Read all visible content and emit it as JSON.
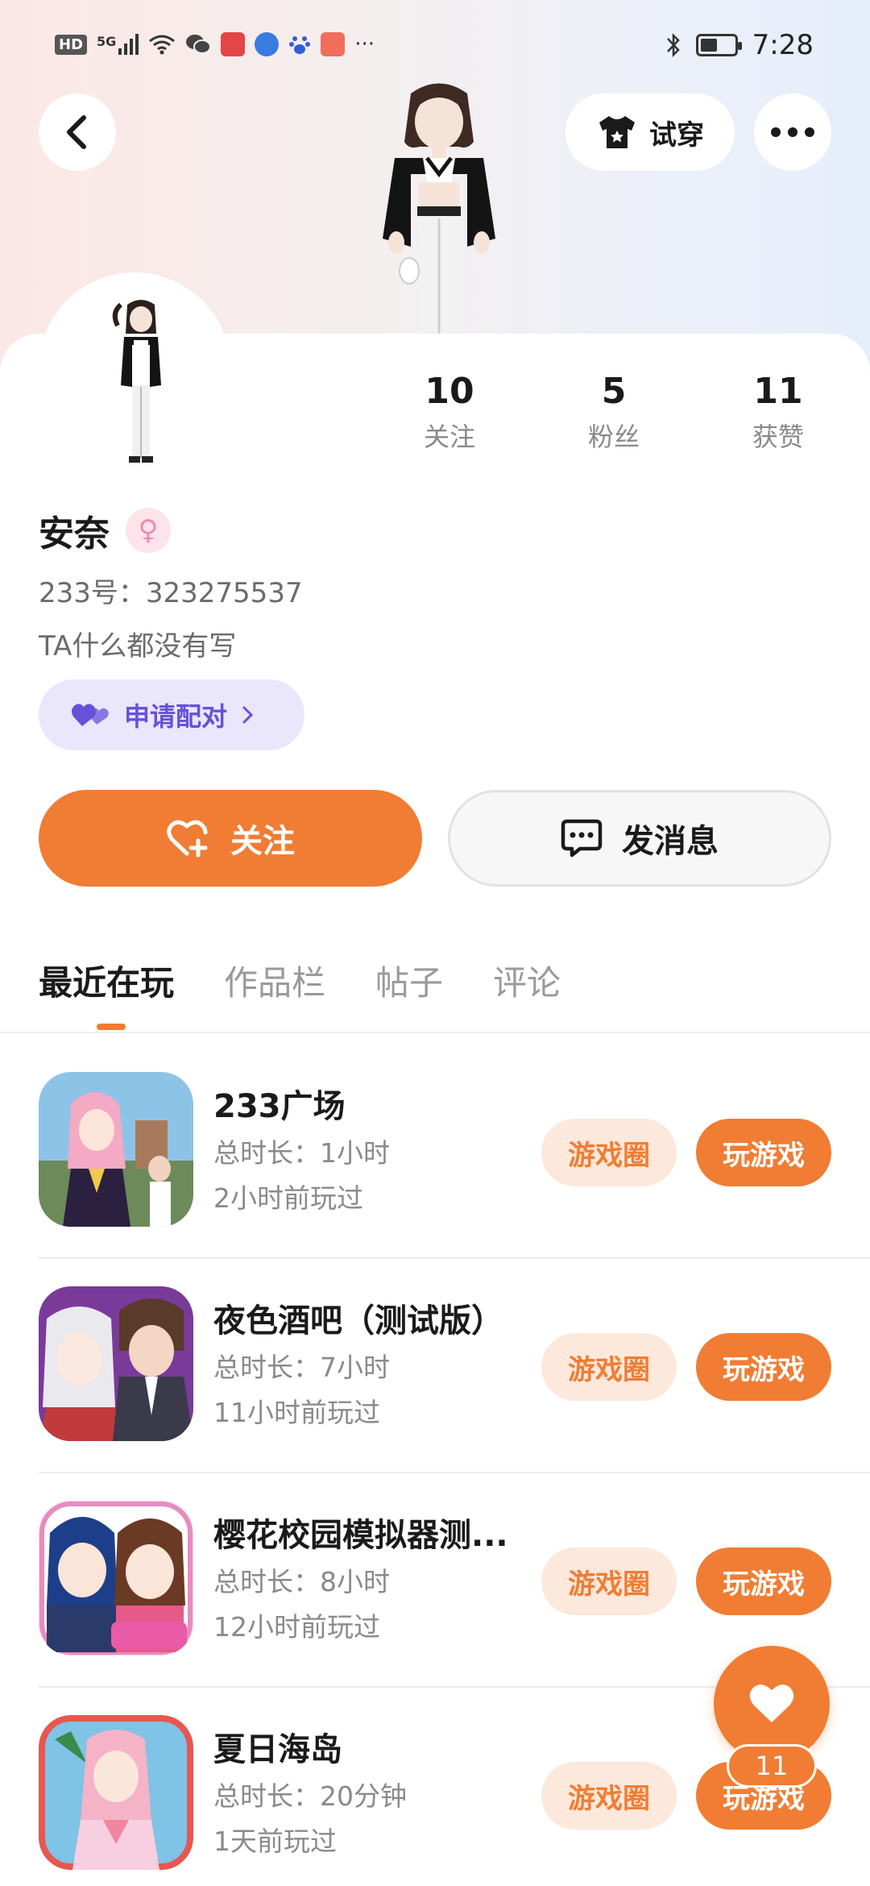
{
  "status_bar": {
    "network_badge": "HD",
    "signal_label": "5G",
    "more_dots": "···",
    "time": "7:28",
    "battery_level": 0.5
  },
  "header": {
    "try_on_label": "试穿"
  },
  "profile": {
    "stats": [
      {
        "value": "10",
        "label": "关注"
      },
      {
        "value": "5",
        "label": "粉丝"
      },
      {
        "value": "11",
        "label": "获赞"
      }
    ],
    "name": "安奈",
    "gender_symbol": "♀",
    "uid_text": "233号：323275537",
    "bio": "TA什么都没有写",
    "pair_label": "申请配对"
  },
  "actions": {
    "follow_label": "关注",
    "message_label": "发消息"
  },
  "tabs": [
    {
      "label": "最近在玩",
      "active": true
    },
    {
      "label": "作品栏",
      "active": false
    },
    {
      "label": "帖子",
      "active": false
    },
    {
      "label": "评论",
      "active": false
    }
  ],
  "games": [
    {
      "title": "233广场",
      "duration": "总时长：1小时",
      "last_played": "2小时前玩过",
      "circle_label": "游戏圈",
      "play_label": "玩游戏"
    },
    {
      "title": "夜色酒吧（测试版）",
      "duration": "总时长：7小时",
      "last_played": "11小时前玩过",
      "circle_label": "游戏圈",
      "play_label": "玩游戏"
    },
    {
      "title": "樱花校园模拟器测...",
      "duration": "总时长：8小时",
      "last_played": "12小时前玩过",
      "circle_label": "游戏圈",
      "play_label": "玩游戏"
    },
    {
      "title": "夏日海岛",
      "duration": "总时长：20分钟",
      "last_played": "1天前玩过",
      "circle_label": "游戏圈",
      "play_label": "玩游戏"
    }
  ],
  "like_fab": {
    "count": "11"
  },
  "colors": {
    "accent": "#f07d33",
    "pair_bg": "#eae6fb",
    "pair_text": "#6651d9"
  }
}
